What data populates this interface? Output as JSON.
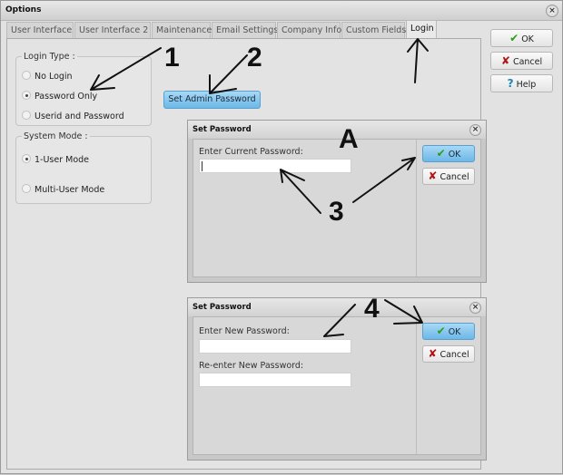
{
  "window": {
    "title": "Options",
    "close_icon": "close-icon"
  },
  "tabs": [
    {
      "label": "User Interface",
      "active": false
    },
    {
      "label": "User Interface 2",
      "active": false
    },
    {
      "label": "Maintenance",
      "active": false
    },
    {
      "label": "Email Settings",
      "active": false
    },
    {
      "label": "Company Info",
      "active": false
    },
    {
      "label": "Custom Fields",
      "active": false
    },
    {
      "label": "Login",
      "active": true
    }
  ],
  "side_buttons": {
    "ok": {
      "label": "OK",
      "icon": "checkmark-icon"
    },
    "cancel": {
      "label": "Cancel",
      "icon": "x-icon"
    },
    "help": {
      "label": "Help",
      "icon": "question-icon"
    }
  },
  "login_type": {
    "legend": "Login Type :",
    "options": [
      {
        "label": "No Login",
        "checked": false
      },
      {
        "label": "Password Only",
        "checked": true
      },
      {
        "label": "Userid and Password",
        "checked": false
      }
    ]
  },
  "system_mode": {
    "legend": "System Mode :",
    "options": [
      {
        "label": "1-User Mode",
        "checked": true
      },
      {
        "label": "Multi-User Mode",
        "checked": false
      }
    ]
  },
  "set_admin_password_button": "Set Admin Password",
  "dialog_current": {
    "title": "Set Password",
    "field_label": "Enter Current Password:",
    "field_value": "",
    "ok_label": "OK",
    "cancel_label": "Cancel"
  },
  "dialog_new": {
    "title": "Set Password",
    "new_label": "Enter New Password:",
    "new_value": "",
    "reenter_label": "Re-enter New Password:",
    "reenter_value": "",
    "ok_label": "OK",
    "cancel_label": "Cancel"
  },
  "annotations": {
    "one": "1",
    "two": "2",
    "three": "3",
    "four": "4",
    "a": "A"
  },
  "colors": {
    "primary_button": "#6cb8e8",
    "ok_check": "#2f9b1a",
    "cancel_x": "#b01515",
    "help_q": "#1d86b8"
  }
}
